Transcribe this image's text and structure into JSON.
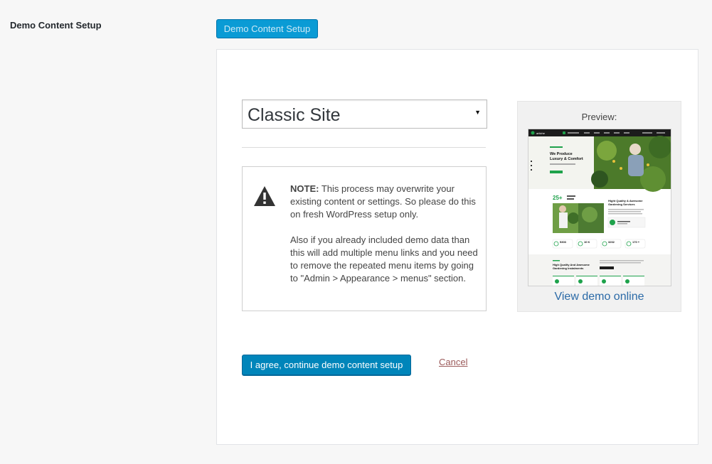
{
  "row": {
    "label": "Demo Content Setup"
  },
  "top_button": {
    "label": "Demo Content Setup"
  },
  "select": {
    "value": "Classic Site"
  },
  "note": {
    "bold": "NOTE:",
    "line1": " This process may overwrite your existing content or settings. So please do this on fresh WordPress setup only.",
    "para2": "Also if you already included demo data than this will add multiple menu links and you need to remove the repeated menu items by going to \"Admin > Appearance > menus\" section."
  },
  "preview": {
    "title": "Preview:",
    "link": "View demo online",
    "thumb_text": {
      "logo": "artiche",
      "hero": "We Produce Luxury & Comfort",
      "stat": "25+",
      "section_a": "Hight Quality & Awesome Gardening Services",
      "section_b": "High Quality And Awesome Gardening Instalments",
      "counts": [
        "5303",
        "10 K",
        "3202",
        "170 +"
      ]
    }
  },
  "actions": {
    "agree": "I agree, continue demo content setup",
    "cancel": "Cancel"
  },
  "colors": {
    "primary": "#0085ba",
    "top_button": "#0a9bd5",
    "link": "#2b6aa7",
    "preview_accent": "#1ea24b"
  }
}
